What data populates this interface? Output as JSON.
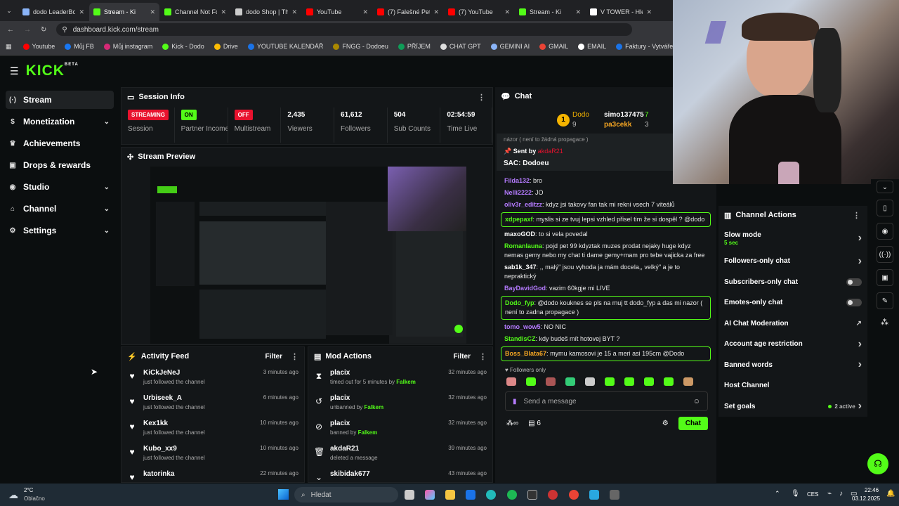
{
  "browser": {
    "tabs": [
      {
        "title": "dodo LeaderBo",
        "color": "#8ab4f8",
        "active": false
      },
      {
        "title": "Stream - Ki",
        "color": "#53fc18",
        "active": true
      },
      {
        "title": "Channel Not Fo",
        "color": "#53fc18",
        "active": false
      },
      {
        "title": "dodo Shop | Th",
        "color": "#cccccc",
        "active": false
      },
      {
        "title": "YouTube",
        "color": "#ff0000",
        "active": false
      },
      {
        "title": "(7) Falešné Pet",
        "color": "#ff0000",
        "active": false
      },
      {
        "title": "(7) YouTube",
        "color": "#ff0000",
        "active": false
      },
      {
        "title": "Stream - Ki",
        "color": "#53fc18",
        "active": false
      },
      {
        "title": "V TOWER - Hle",
        "color": "#ffffff",
        "active": false
      }
    ],
    "url": "dashboard.kick.com/stream",
    "bookmarks": [
      {
        "label": "Youtube",
        "color": "#ff0000"
      },
      {
        "label": "Můj FB",
        "color": "#1877f2"
      },
      {
        "label": "Můj instagram",
        "color": "#d62976"
      },
      {
        "label": "Kick - Dodo",
        "color": "#53fc18"
      },
      {
        "label": "Drive",
        "color": "#fbbc04"
      },
      {
        "label": "YOUTUBE KALENDÁŘ",
        "color": "#1a73e8"
      },
      {
        "label": "FNGG - Dodoeu",
        "color": "#aa8800"
      },
      {
        "label": "PŘÍJEM",
        "color": "#0f9d58"
      },
      {
        "label": "CHAT GPT",
        "color": "#dddddd"
      },
      {
        "label": "GEMINI AI",
        "color": "#8ab4f8"
      },
      {
        "label": "GMAIL",
        "color": "#ea4335"
      },
      {
        "label": "EMAIL",
        "color": "#ffffff"
      },
      {
        "label": "Faktury - Vytváření",
        "color": "#1a73e8"
      },
      {
        "label": "PNG to PDF",
        "color": "#ea4335"
      }
    ]
  },
  "kick": {
    "logo": "KICK",
    "logo_tag": "BETA"
  },
  "sidebar": {
    "items": [
      {
        "label": "Stream",
        "icon": "stream-icon",
        "glyph": "(·)",
        "chevron": false,
        "active": true
      },
      {
        "label": "Monetization",
        "icon": "dollar-icon",
        "glyph": "$",
        "chevron": true,
        "active": false
      },
      {
        "label": "Achievements",
        "icon": "trophy-icon",
        "glyph": "♛",
        "chevron": false,
        "active": false
      },
      {
        "label": "Drops & rewards",
        "icon": "gift-icon",
        "glyph": "▣",
        "chevron": false,
        "active": false
      },
      {
        "label": "Studio",
        "icon": "joystick-icon",
        "glyph": "◉",
        "chevron": true,
        "active": false
      },
      {
        "label": "Channel",
        "icon": "channel-icon",
        "glyph": "⌂",
        "chevron": true,
        "active": false
      },
      {
        "label": "Settings",
        "icon": "gear-icon",
        "glyph": "⚙",
        "chevron": true,
        "active": false
      }
    ]
  },
  "session": {
    "title": "Session Info",
    "stats": [
      {
        "value": "STREAMING",
        "label": "Session",
        "badge": true,
        "bg": "#e8122e",
        "fg": "#ffffff",
        "w": 76
      },
      {
        "value": "ON",
        "label": "Partner Income",
        "badge": true,
        "bg": "#53fc18",
        "fg": "#000000",
        "w": 76
      },
      {
        "value": "OFF",
        "label": "Multistream",
        "badge": true,
        "bg": "#e8122e",
        "fg": "#ffffff",
        "w": 76
      },
      {
        "value": "2,435",
        "label": "Viewers",
        "badge": false,
        "w": 76
      },
      {
        "value": "61,612",
        "label": "Followers",
        "badge": false,
        "w": 76
      },
      {
        "value": "504",
        "label": "Sub Counts",
        "badge": false,
        "w": 76
      },
      {
        "value": "02:54:59",
        "label": "Time Live",
        "badge": false,
        "w": 74
      }
    ]
  },
  "preview": {
    "title": "Stream Preview"
  },
  "activity": {
    "title": "Activity Feed",
    "filter": "Filter",
    "items": [
      {
        "name": "KiCkJeNeJ",
        "sub": "just followed the channel",
        "time": "3 minutes ago"
      },
      {
        "name": "Urbiseek_A",
        "sub": "just followed the channel",
        "time": "6 minutes ago"
      },
      {
        "name": "Kex1kk",
        "sub": "just followed the channel",
        "time": "10 minutes ago"
      },
      {
        "name": "Kubo_xx9",
        "sub": "just followed the channel",
        "time": "10 minutes ago"
      },
      {
        "name": "katorinka",
        "sub": "",
        "time": "22 minutes ago"
      }
    ]
  },
  "mod": {
    "title": "Mod Actions",
    "filter": "Filter",
    "items": [
      {
        "name": "placix",
        "sub": "timed out for 5 minutes by",
        "by": "Falkem",
        "time": "32 minutes ago",
        "glyph": "⧗",
        "icon": "hourglass-icon"
      },
      {
        "name": "placix",
        "sub": "unbanned by",
        "by": "Falkem",
        "time": "32 minutes ago",
        "glyph": "↺",
        "icon": "undo-icon"
      },
      {
        "name": "placix",
        "sub": "banned by",
        "by": "Falkem",
        "time": "32 minutes ago",
        "glyph": "⊘",
        "icon": "ban-icon"
      },
      {
        "name": "akdaR21",
        "sub": "deleted a message",
        "by": "",
        "time": "39 minutes ago",
        "glyph": "🗑",
        "icon": "trash-icon"
      },
      {
        "name": "skibidak677",
        "sub": "",
        "by": "",
        "time": "43 minutes ago",
        "glyph": "⌄",
        "icon": "chevron-icon"
      }
    ]
  },
  "chat": {
    "title": "Chat",
    "leader1": {
      "rank": "1",
      "name": "Dodo",
      "count": "9"
    },
    "leader2": {
      "name": "simo137475",
      "count": "7"
    },
    "leader3": {
      "name": "pa3cekk",
      "count": "3"
    },
    "pinned_prev": "názor ( není to žádná propagace )",
    "pinned_sent_label": "Sent by",
    "pinned_sender": "akdaR21",
    "pinned_text": "SAC: Dodoeu",
    "messages": [
      {
        "user": "Filda132",
        "color": "#b57bff",
        "text": "bro",
        "hl": false
      },
      {
        "user": "Nelli2222",
        "color": "#b57bff",
        "text": "JO",
        "hl": false
      },
      {
        "user": "oliv3r_editzz",
        "color": "#b57bff",
        "text": "kdyz jsi takovy fan tak mi rekni vsech 7 viteálů",
        "hl": false
      },
      {
        "user": "xdpepaxf",
        "color": "#53fc18",
        "text": "myslis si ze tvuj lepsi vzhled přisel tim že si dospěl ? @dodo",
        "hl": true
      },
      {
        "user": "maxoGOD",
        "color": "#ffffff",
        "text": "to si vela povedal",
        "hl": false
      },
      {
        "user": "Romanlauna",
        "color": "#53fc18",
        "text": "pojd pet 99 kdyztak muzes prodat nejaky huge kdyz nemas gemy nebo my chat ti dame gemy+mam pro tebe vajicka za free",
        "hl": false
      },
      {
        "user": "sab1k_347",
        "color": "#ffffff",
        "text": ",, malý\" jsou vyhoda ja mám docela,, velký\" a je to nepraktický",
        "hl": false
      },
      {
        "user": "BayDavidGod",
        "color": "#b57bff",
        "text": "vazim 60kgje mi LIVE",
        "hl": false
      },
      {
        "user": "Dodo_fyp",
        "color": "#53fc18",
        "text": "@dodo kouknes se pls na muj tt dodo_fyp a das mi nazor ( není to zadna propagace )",
        "hl": true
      },
      {
        "user": "tomo_wow5",
        "color": "#b57bff",
        "text": "NO NIC",
        "hl": false
      },
      {
        "user": "StandisCZ",
        "color": "#53fc18",
        "text": "kdy budeš mít hotovej BYT ?",
        "hl": false
      },
      {
        "user": "Boss_Blata67",
        "color": "#f5a623",
        "text": "mymu kamosovi je 15 a meri asi 195cm @Dodo",
        "hl": true
      }
    ],
    "followers_only": "Followers only",
    "placeholder": "Send a message",
    "count": "6",
    "send": "Chat"
  },
  "actions": {
    "title": "Channel Actions",
    "items": [
      {
        "label": "Slow mode",
        "sub": "5 sec",
        "kind": "chevron"
      },
      {
        "label": "Followers-only chat",
        "sub": "",
        "kind": "chevron"
      },
      {
        "label": "Subscribers-only chat",
        "sub": "",
        "kind": "toggle"
      },
      {
        "label": "Emotes-only chat",
        "sub": "",
        "kind": "toggle"
      },
      {
        "label": "AI Chat Moderation",
        "sub": "",
        "kind": "external"
      },
      {
        "label": "Account age restriction",
        "sub": "",
        "kind": "chevron"
      },
      {
        "label": "Banned words",
        "sub": "",
        "kind": "chevron"
      },
      {
        "label": "Host Channel",
        "sub": "",
        "kind": "none"
      },
      {
        "label": "Set goals",
        "sub": "",
        "kind": "active",
        "extra": "2 active"
      }
    ]
  },
  "taskbar": {
    "weather_temp": "2°C",
    "weather_text": "Oblačno",
    "search": "Hledat",
    "lang": "CES",
    "time": "22:46",
    "date": "03.12.2025"
  }
}
